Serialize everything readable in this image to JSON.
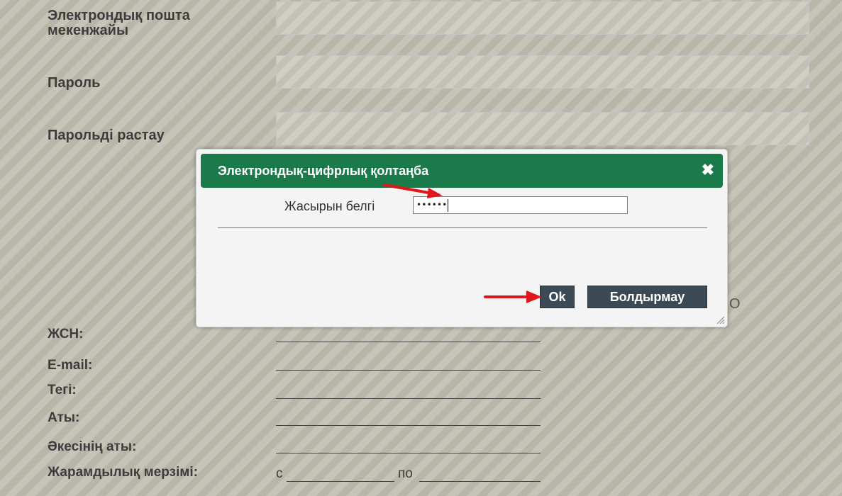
{
  "form": {
    "email_label": "Электрондық пошта мекенжайы",
    "password_label": "Пароль",
    "confirm_password_label": "Парольді растау"
  },
  "info": {
    "iin_label": "ЖСН:",
    "email_label": "E-mail:",
    "surname_label": "Тегі:",
    "name_label": "Аты:",
    "patronymic_label": "Әкесінің аты:",
    "validity_label": "Жарамдылық мерзімі:",
    "validity_from": "с",
    "validity_to": "по"
  },
  "background_fragment": "O",
  "dialog": {
    "title": "Электрондық-цифрлық қолтаңба",
    "password_label": "Жасырын белгі",
    "password_value": "••••••",
    "ok_label": "Ok",
    "cancel_label": "Болдырмау"
  },
  "colors": {
    "header_green": "#1b7a4a",
    "button_dark": "#3b4a55",
    "arrow_red": "#e0161b"
  }
}
